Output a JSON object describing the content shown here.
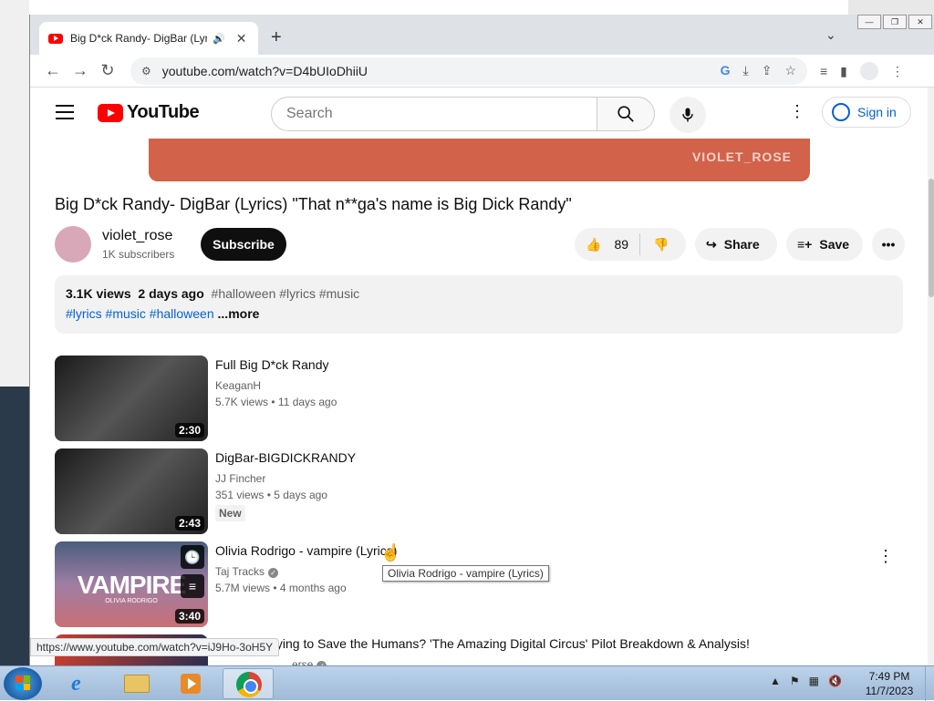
{
  "browser": {
    "tab_title": "Big D*ck Randy- DigBar (Lyric",
    "tab_audio_icon": "speaker-icon",
    "url": "youtube.com/watch?v=D4bUIoDhiiU",
    "new_tab_label": "+",
    "tab_dropdown": "⌄",
    "back": "←",
    "forward": "→",
    "reload": "↻"
  },
  "youtube": {
    "logo_text": "YouTube",
    "search_placeholder": "Search",
    "signin_label": "Sign in",
    "banner_text": "VIOLET_ROSE",
    "brand_color": "#ff0000"
  },
  "video": {
    "title": "Big D*ck Randy- DigBar (Lyrics) \"That n**ga's name is Big Dick Randy\"",
    "channel": "violet_rose",
    "subscribers": "1K subscribers",
    "subscribe_label": "Subscribe",
    "likes": "89",
    "share_label": "Share",
    "save_label": "Save",
    "views": "3.1K views",
    "age": "2 days ago",
    "tags_line1": "#halloween #lyrics #music",
    "tags_line2": "#lyrics #music #halloween",
    "more_label": "...more"
  },
  "recommendations": [
    {
      "title": "Full Big D*ck Randy",
      "channel": "KeaganH",
      "views": "5.7K views",
      "age": "11 days ago",
      "duration": "2:30"
    },
    {
      "title": "DigBar-BIGDICKRANDY",
      "channel": "JJ Fincher",
      "views": "351 views",
      "age": "5 days ago",
      "duration": "2:43",
      "badge": "New"
    },
    {
      "title": "Olivia Rodrigo - vampire (Lyrics)",
      "channel": "Taj Tracks",
      "views": "5.7M views",
      "age": "4 months ago",
      "duration": "3:40",
      "thumb_text": "VAMPIRE",
      "thumb_sub": "OLIVIA RODRIGO"
    },
    {
      "title": "Caine is Trying to Save the Humans? 'The Amazing Digital Circus' Pilot Breakdown & Analysis!",
      "channel": "erse"
    }
  ],
  "tooltip": "Olivia Rodrigo - vampire (Lyrics)",
  "status_url": "https://www.youtube.com/watch?v=iJ9Ho-3oH5Y",
  "taskbar": {
    "time": "7:49 PM",
    "date": "11/7/2023"
  }
}
